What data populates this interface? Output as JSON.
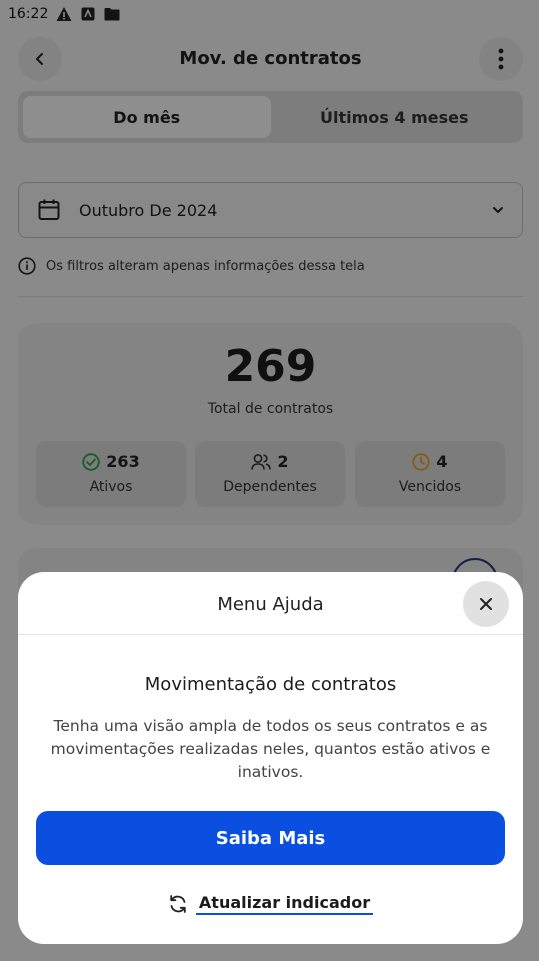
{
  "status_bar": {
    "time": "16:22",
    "icons": [
      "warning-icon",
      "app-icon",
      "folder-icon"
    ]
  },
  "header": {
    "title": "Mov. de contratos",
    "back_icon": "chevron-left-icon",
    "more_icon": "more-vertical-icon"
  },
  "period_tabs": [
    {
      "label": "Do mês",
      "selected": true
    },
    {
      "label": "Últimos 4 meses",
      "selected": false
    }
  ],
  "date_filter": {
    "value": "Outubro De 2024",
    "icon": "calendar-icon",
    "chevron": "chevron-down-icon"
  },
  "info_note": {
    "text": "Os filtros alteram apenas informações dessa tela",
    "icon": "info-icon"
  },
  "summary": {
    "total": "269",
    "total_label": "Total de contratos",
    "stats": [
      {
        "value": "263",
        "label": "Ativos",
        "icon": "check-circle-icon",
        "color": "#2e9c47"
      },
      {
        "value": "2",
        "label": "Dependentes",
        "icon": "users-icon",
        "color": "#333333"
      },
      {
        "value": "4",
        "label": "Vencidos",
        "icon": "clock-icon",
        "color": "#e0a020"
      }
    ]
  },
  "help_sheet": {
    "title": "Menu Ajuda",
    "heading": "Movimentação de contratos",
    "body": "Tenha uma visão ampla de todos os seus contratos e as movimentações realizadas neles, quantos estão ativos e inativos.",
    "primary_button": "Saiba Mais",
    "refresh_link": "Atualizar indicador",
    "accent_color": "#0a4fe0"
  }
}
